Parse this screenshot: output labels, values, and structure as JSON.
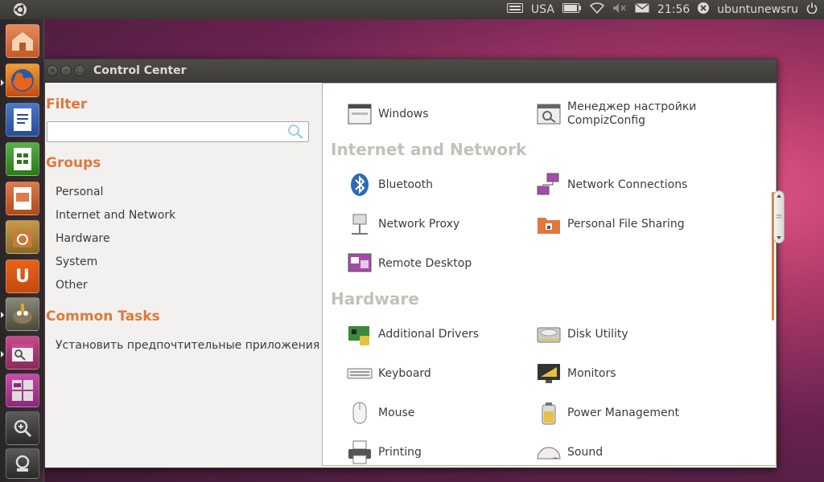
{
  "top_panel": {
    "keyboard_layout": "USA",
    "time": "21:56",
    "user": "ubuntunewsru",
    "icons": [
      "keyboard-icon",
      "battery-icon",
      "wifi-icon",
      "volume-muted-icon",
      "mail-icon",
      "user-icon",
      "power-icon"
    ]
  },
  "launcher": {
    "items": [
      "home-folder",
      "firefox",
      "writer",
      "calc",
      "impress",
      "ubuntu-software-center",
      "ubuntu-one",
      "gimp",
      "control-center",
      "workspaces",
      "applications-lens",
      "files-lens"
    ]
  },
  "window": {
    "title": "Control Center",
    "close_glyph": "×",
    "minimize_glyph": "–",
    "maximize_glyph": "□"
  },
  "sidebar": {
    "filter_heading": "Filter",
    "filter_value": "",
    "groups_heading": "Groups",
    "groups": [
      "Personal",
      "Internet and Network",
      "Hardware",
      "System",
      "Other"
    ],
    "common_tasks_heading": "Common Tasks",
    "tasks": [
      "Установить предпочтительные приложения"
    ]
  },
  "content": {
    "top_items": [
      {
        "label": "Windows",
        "icon": "windows-icon"
      },
      {
        "label": "Менеджер настройки CompizConfig",
        "icon": "compizconfig-icon"
      }
    ],
    "sections": [
      {
        "title": "Internet and Network",
        "items": [
          {
            "label": "Bluetooth",
            "icon": "bluetooth-icon"
          },
          {
            "label": "Network Connections",
            "icon": "network-connections-icon"
          },
          {
            "label": "Network Proxy",
            "icon": "network-proxy-icon"
          },
          {
            "label": "Personal File Sharing",
            "icon": "file-sharing-icon"
          },
          {
            "label": "Remote Desktop",
            "icon": "remote-desktop-icon"
          }
        ]
      },
      {
        "title": "Hardware",
        "items": [
          {
            "label": "Additional Drivers",
            "icon": "additional-drivers-icon"
          },
          {
            "label": "Disk Utility",
            "icon": "disk-utility-icon"
          },
          {
            "label": "Keyboard",
            "icon": "keyboard-icon"
          },
          {
            "label": "Monitors",
            "icon": "monitors-icon"
          },
          {
            "label": "Mouse",
            "icon": "mouse-icon"
          },
          {
            "label": "Power Management",
            "icon": "power-management-icon"
          },
          {
            "label": "Printing",
            "icon": "printing-icon"
          },
          {
            "label": "Sound",
            "icon": "sound-icon"
          }
        ]
      }
    ]
  },
  "colors": {
    "accent": "#e0783a",
    "section_title": "#c4c0ba",
    "panel": "#3c3b37"
  }
}
